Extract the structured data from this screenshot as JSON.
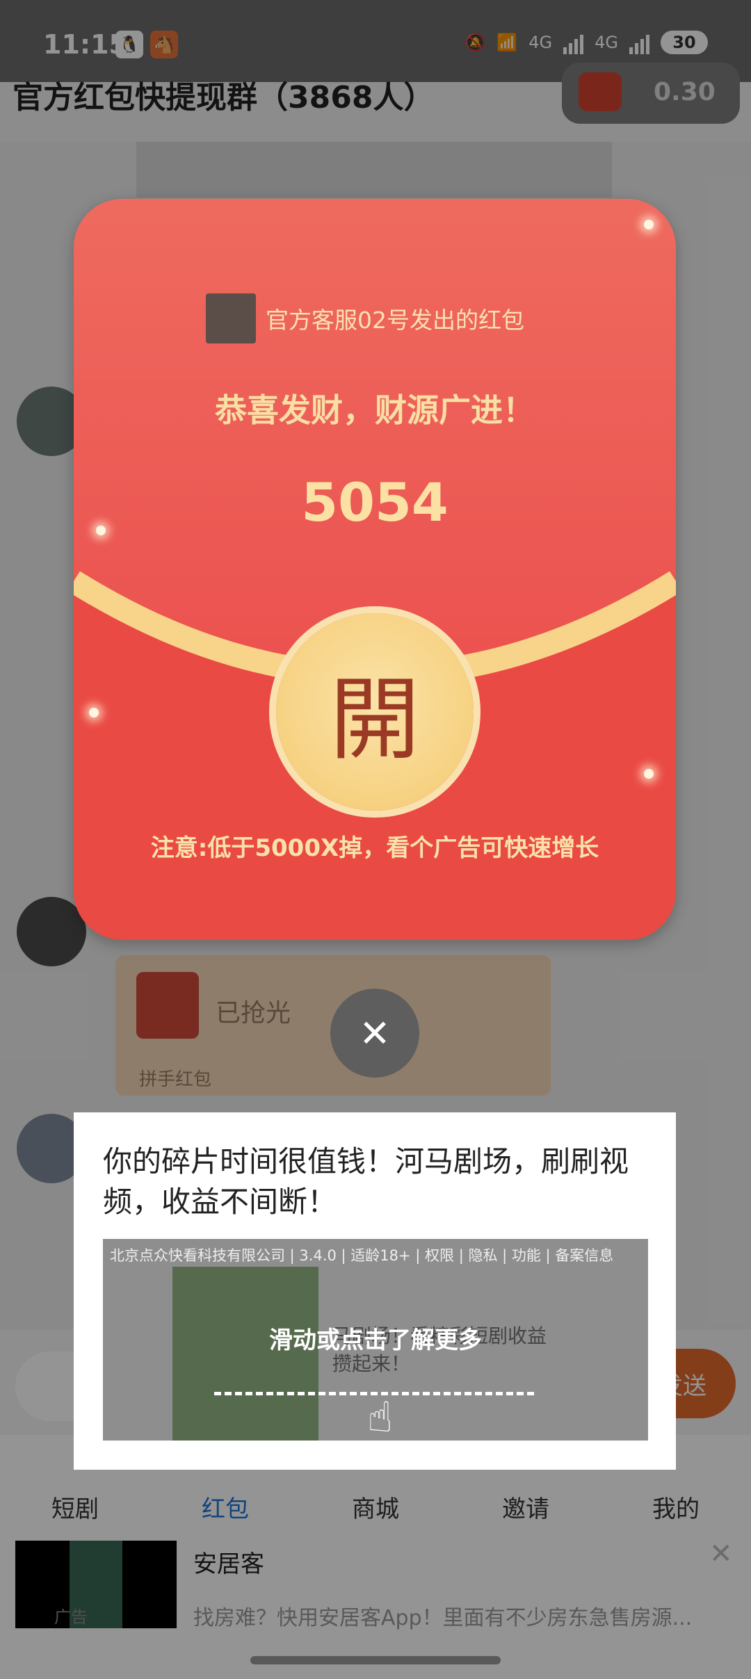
{
  "status_bar": {
    "time": "11:15",
    "network_1": "4G",
    "network_2": "4G",
    "battery": "30"
  },
  "header": {
    "title": "官方红包快提现群（3868人）",
    "coin_value": "0.30"
  },
  "chat": {
    "grab_status": "已抢光",
    "grab_sub": "拼手红包"
  },
  "input_bar": {
    "send_label": "发送"
  },
  "tabs": [
    {
      "label": "短剧"
    },
    {
      "label": "红包"
    },
    {
      "label": "商城"
    },
    {
      "label": "邀请"
    },
    {
      "label": "我的"
    }
  ],
  "active_tab_color": "#1f73d6",
  "bottom_ad": {
    "tag": "广告",
    "title": "安居客",
    "desc": "找房难？快用安居客App！里面有不少房东急售房源..."
  },
  "envelope": {
    "sender": "官方客服02号发出的红包",
    "greeting": "恭喜发财，财源广进！",
    "amount": "5054",
    "open_label": "開",
    "notice": "注意:低于5000X掉，看个广告可快速增长",
    "color": "#ec5350",
    "accent": "#f6d181"
  },
  "ad_modal": {
    "headline": "你的碎片时间很值钱！河马剧场，刷刷视频，收益不间断！",
    "company_line": "北京点众快看科技有限公司 | 3.4.0 | 适龄18+ | 权限 | 隐私 | 功能 | 备案信息",
    "video_text": "马剧场！看精彩短剧收益攒起来！",
    "cta": "滑动或点击了解更多"
  }
}
